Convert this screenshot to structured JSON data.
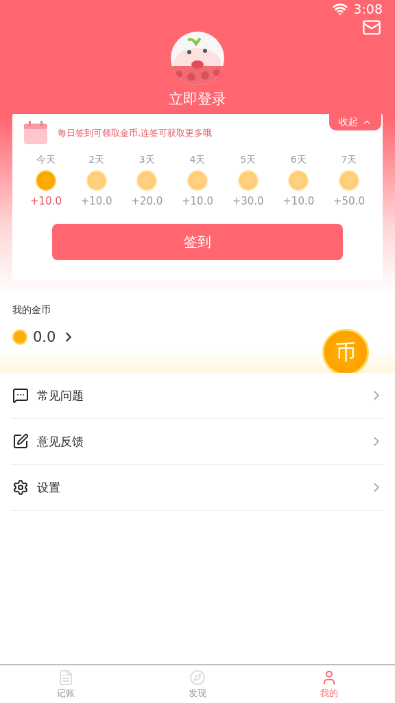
{
  "status_bar": {
    "time": "3:08"
  },
  "profile": {
    "login": "立即登录"
  },
  "checkin": {
    "collapse": "收起",
    "hint": "每日签到可领取金币,连签可获取更多哦",
    "days": [
      {
        "label": "今天",
        "reward": "+10.0",
        "selected": true
      },
      {
        "label": "2天",
        "reward": "+10.0",
        "selected": false
      },
      {
        "label": "3天",
        "reward": "+20.0",
        "selected": false
      },
      {
        "label": "4天",
        "reward": "+10.0",
        "selected": false
      },
      {
        "label": "5天",
        "reward": "+30.0",
        "selected": false
      },
      {
        "label": "6天",
        "reward": "+10.0",
        "selected": false
      },
      {
        "label": "7天",
        "reward": "+50.0",
        "selected": false
      }
    ],
    "button": "签到"
  },
  "coins": {
    "title": "我的金币",
    "amount": "0.0",
    "big_coin": "币"
  },
  "menu": [
    {
      "kind": "faq",
      "label": "常见问题"
    },
    {
      "kind": "feedback",
      "label": "意见反馈"
    },
    {
      "kind": "settings",
      "label": "设置"
    }
  ],
  "tabs": [
    {
      "kind": "ledger",
      "label": "记账",
      "selected": false
    },
    {
      "kind": "discover",
      "label": "发现",
      "selected": false
    },
    {
      "kind": "me",
      "label": "我的",
      "selected": true
    }
  ]
}
